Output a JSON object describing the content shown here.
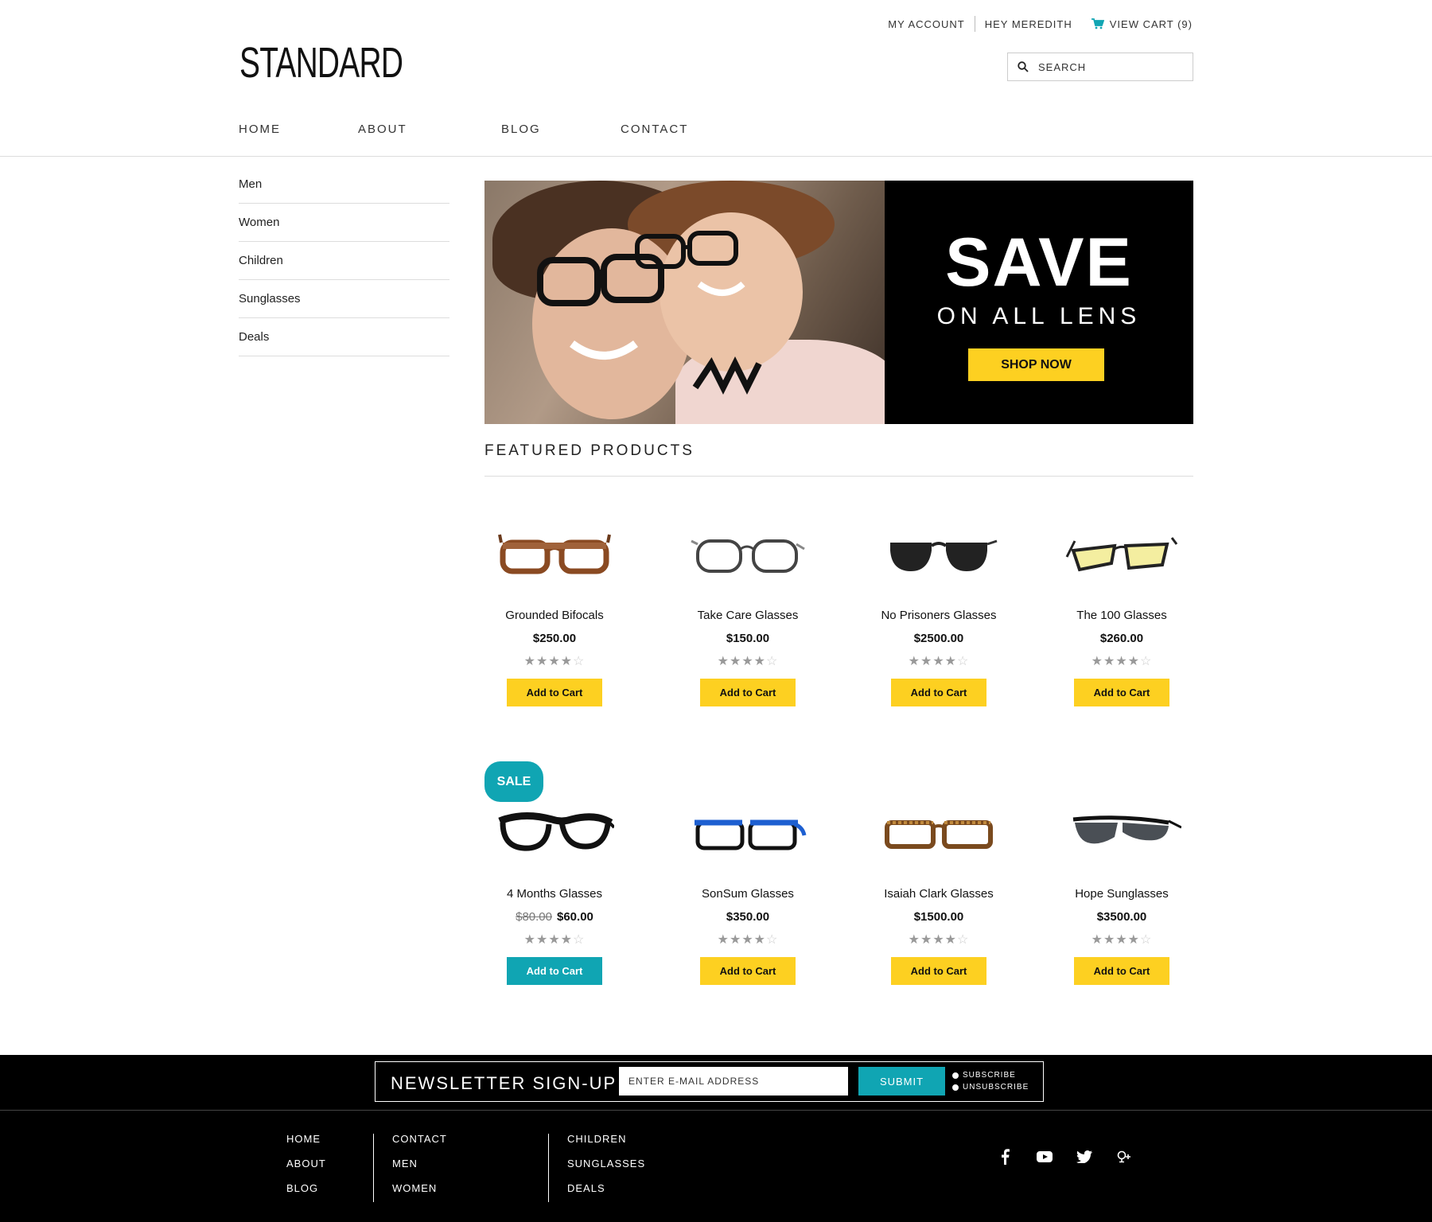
{
  "header": {
    "my_account": "MY ACCOUNT",
    "greeting": "HEY MEREDITH",
    "cart": "VIEW CART (9)",
    "logo": "STANDARD",
    "search_placeholder": "SEARCH",
    "nav": [
      "HOME",
      "ABOUT",
      "BLOG",
      "CONTACT"
    ]
  },
  "sidebar": {
    "items": [
      "Men",
      "Women",
      "Children",
      "Sunglasses",
      "Deals"
    ]
  },
  "banner": {
    "headline": "SAVE",
    "subline": "ON ALL LENS",
    "cta": "SHOP NOW"
  },
  "featured": {
    "title": "FEATURED PRODUCTS",
    "sale_badge": "SALE",
    "add_to_cart": "Add to Cart",
    "products": [
      {
        "name": "Grounded Bifocals",
        "price": "$250.00",
        "rating": 4,
        "icon": "tortoise-glasses-icon"
      },
      {
        "name": "Take Care Glasses",
        "price": "$150.00",
        "rating": 4,
        "icon": "grey-glasses-icon"
      },
      {
        "name": "No Prisoners Glasses",
        "price": "$2500.00",
        "rating": 4,
        "icon": "sunglasses-icon"
      },
      {
        "name": "The 100 Glasses",
        "price": "$260.00",
        "rating": 4,
        "icon": "yellow-lens-glasses-icon"
      },
      {
        "name": "4 Months Glasses",
        "old_price": "$80.00",
        "price": "$60.00",
        "rating": 4,
        "icon": "black-glasses-icon"
      },
      {
        "name": "SonSum Glasses",
        "price": "$350.00",
        "rating": 4,
        "icon": "blue-glasses-icon"
      },
      {
        "name": "Isaiah Clark Glasses",
        "price": "$1500.00",
        "rating": 4,
        "icon": "tortoise-rect-glasses-icon"
      },
      {
        "name": "Hope Sunglasses",
        "price": "$3500.00",
        "rating": 4,
        "icon": "sport-sunglasses-icon"
      }
    ]
  },
  "newsletter": {
    "label": "NEWSLETTER SIGN-UP",
    "placeholder": "ENTER E-MAIL ADDRESS",
    "submit": "SUBMIT",
    "subscribe": "SUBSCRIBE",
    "unsubscribe": "UNSUBSCRIBE"
  },
  "footer": {
    "col1": [
      "HOME",
      "ABOUT",
      "BLOG"
    ],
    "col2": [
      "CONTACT",
      "MEN",
      "WOMEN"
    ],
    "col3": [
      "CHILDREN",
      "SUNGLASSES",
      "DEALS"
    ],
    "social": [
      "facebook-icon",
      "youtube-icon",
      "twitter-icon",
      "google-plus-icon"
    ]
  },
  "colors": {
    "accent_yellow": "#fdd021",
    "accent_teal": "#10a5b3",
    "footer_bg": "#000000"
  }
}
